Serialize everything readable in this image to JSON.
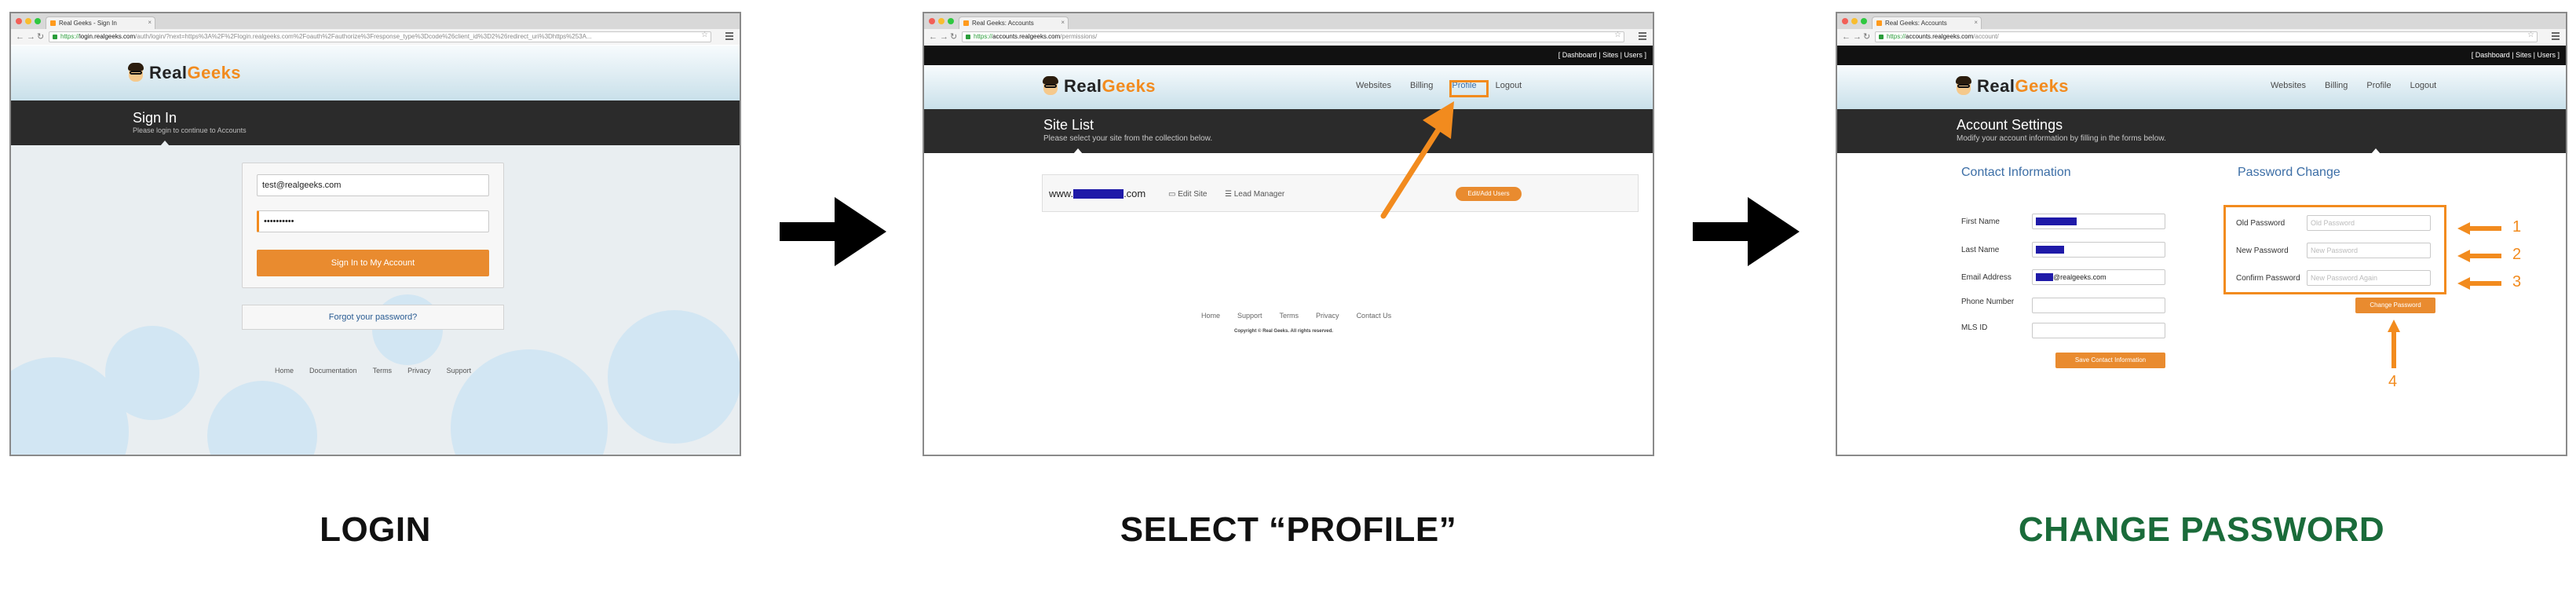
{
  "colors": {
    "accent": "#f28b1e",
    "caption_dark": "#111111",
    "caption_green": "#1a6b3a",
    "dark_bar": "#2b2b2b"
  },
  "steps": [
    {
      "caption": "LOGIN"
    },
    {
      "caption": "SELECT “PROFILE”"
    },
    {
      "caption": "CHANGE PASSWORD"
    }
  ],
  "shot1": {
    "tab_title": "Real Geeks - Sign In",
    "url": {
      "scheme": "https://",
      "host": "login.realgeeks.com",
      "path": "/auth/login/?next=https%3A%2F%2Flogin.realgeeks.com%2Foauth%2Fauthorize%3Fresponse_type%3Dcode%26client_id%3D2%26redirect_uri%3Dhttps%253A..."
    },
    "logo": {
      "real": "Real",
      "geeks": "Geeks"
    },
    "title": "Sign In",
    "subtitle": "Please login to continue to Accounts",
    "email_value": "test@realgeeks.com",
    "password_value": "••••••••••",
    "submit_label": "Sign In to My Account",
    "forgot_label": "Forgot your password?",
    "footer": [
      "Home",
      "Documentation",
      "Terms",
      "Privacy",
      "Support"
    ]
  },
  "shot2": {
    "tab_title": "Real Geeks: Accounts",
    "url": {
      "scheme": "https://",
      "host": "accounts.realgeeks.com",
      "path": "/permissions/"
    },
    "top_links": "[ Dashboard | Sites | Users ]",
    "logo": {
      "real": "Real",
      "geeks": "Geeks"
    },
    "nav": [
      "Websites",
      "Billing",
      "Profile",
      "Logout"
    ],
    "title": "Site List",
    "subtitle": "Please select your site from the collection below.",
    "site": {
      "prefix": "www.",
      "suffix": ".com",
      "edit_site": "Edit Site",
      "lead_manager": "Lead Manager",
      "edit_users": "Edit/Add Users"
    },
    "footer": [
      "Home",
      "Support",
      "Terms",
      "Privacy",
      "Contact Us"
    ],
    "copyright": "Copyright © Real Geeks. All rights reserved."
  },
  "shot3": {
    "tab_title": "Real Geeks: Accounts",
    "url": {
      "scheme": "https://",
      "host": "accounts.realgeeks.com",
      "path": "/account/"
    },
    "top_links": "[ Dashboard | Sites | Users ]",
    "logo": {
      "real": "Real",
      "geeks": "Geeks"
    },
    "nav": [
      "Websites",
      "Billing",
      "Profile",
      "Logout"
    ],
    "title": "Account Settings",
    "subtitle": "Modify your account information by filling in the forms below.",
    "contact": {
      "heading": "Contact Information",
      "labels": [
        "First Name",
        "Last Name",
        "Email Address",
        "Phone Number",
        "MLS ID"
      ],
      "email_suffix": "@realgeeks.com",
      "save_label": "Save Contact Information"
    },
    "password": {
      "heading": "Password Change",
      "labels": [
        "Old Password",
        "New Password",
        "Confirm Password"
      ],
      "placeholders": [
        "Old Password",
        "New Password",
        "New Password Again"
      ],
      "button_label": "Change Password"
    },
    "callouts": [
      "1",
      "2",
      "3",
      "4"
    ]
  }
}
